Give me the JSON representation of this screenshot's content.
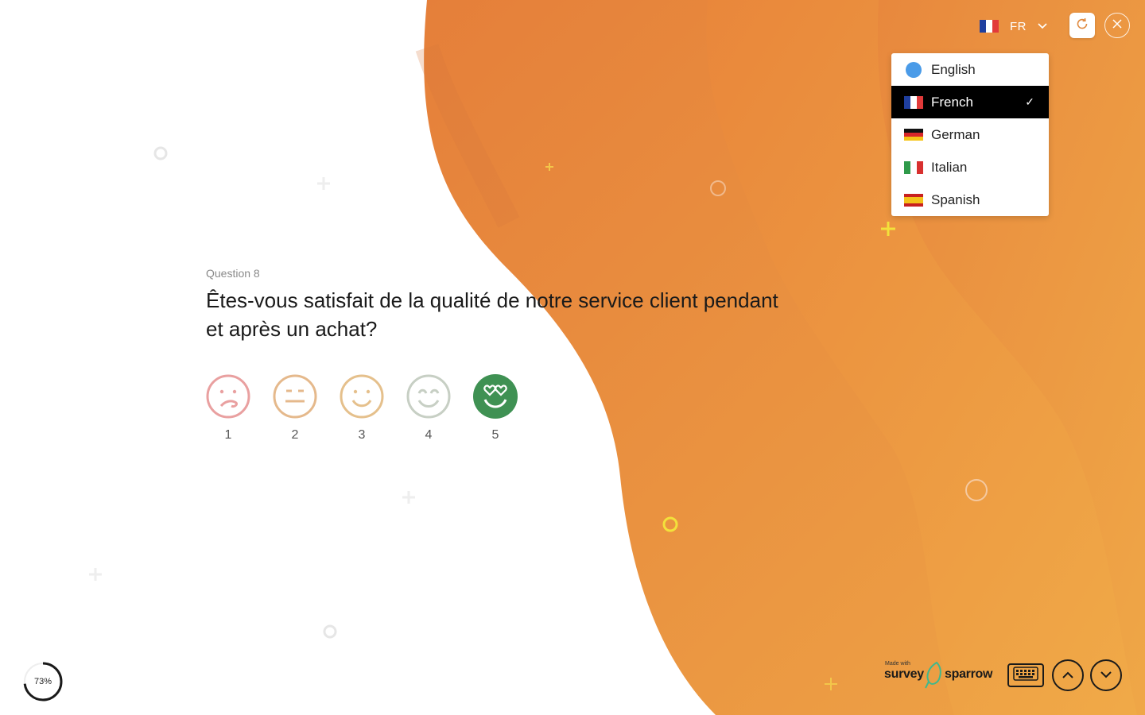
{
  "header": {
    "language_code": "FR",
    "selected_flag": "france-flag"
  },
  "language_menu": {
    "items": [
      {
        "label": "English",
        "icon": "globe-icon"
      },
      {
        "label": "French",
        "icon": "france-flag",
        "selected": true,
        "check": "✓"
      },
      {
        "label": "German",
        "icon": "germany-flag"
      },
      {
        "label": "Italian",
        "icon": "italy-flag"
      },
      {
        "label": "Spanish",
        "icon": "spain-flag"
      }
    ]
  },
  "question": {
    "number_label": "Question 8",
    "title": "Êtes-vous satisfait de la qualité de notre service client pendant et après un achat?"
  },
  "rating": {
    "options": [
      {
        "value": "1",
        "face": "confused-face-icon",
        "color": "#e9a0a0"
      },
      {
        "value": "2",
        "face": "neutral-face-icon",
        "color": "#e5b98c"
      },
      {
        "value": "3",
        "face": "smile-face-icon",
        "color": "#e5c08c"
      },
      {
        "value": "4",
        "face": "happy-face-icon",
        "color": "#c7cfc4"
      },
      {
        "value": "5",
        "face": "heart-eyes-face-icon",
        "color": "#3f9153",
        "selected": true
      }
    ]
  },
  "footer": {
    "progress_percent": 73,
    "progress_label": "73%",
    "brand_made_with": "Made with",
    "brand_survey": "survey",
    "brand_sparrow": "sparrow"
  },
  "colors": {
    "accent_orange": "#e68a3e",
    "selected_green": "#3f9153"
  }
}
